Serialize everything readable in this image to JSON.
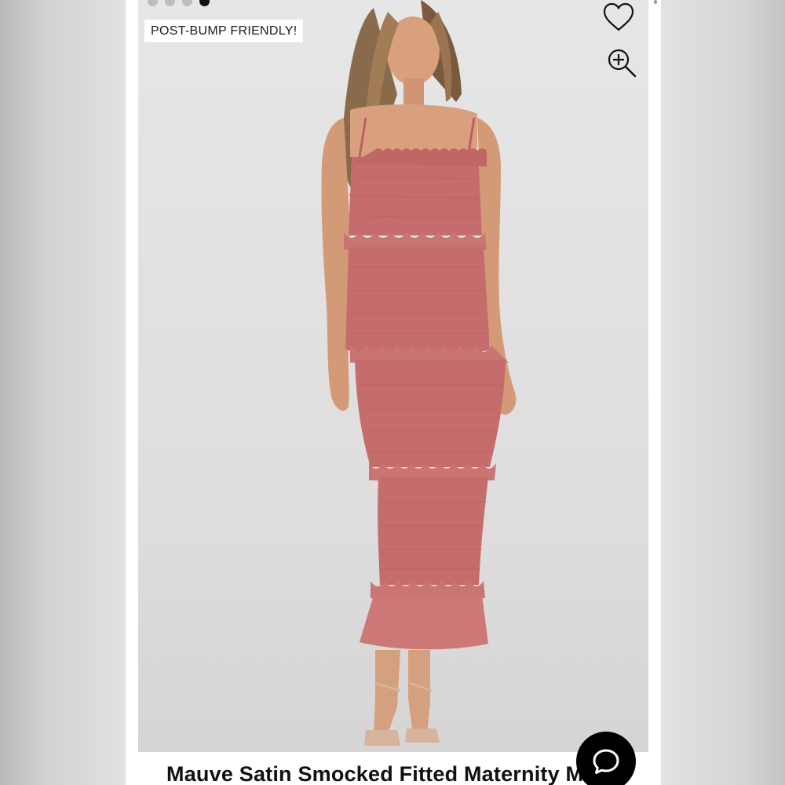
{
  "product": {
    "title": "Mauve Satin Smocked Fitted Maternity M",
    "badge": "POST-BUMP FRIENDLY!"
  },
  "carousel": {
    "total_images": 4,
    "active_index": 3
  },
  "icons": {
    "wishlist": "heart-icon",
    "zoom": "zoom-in-icon",
    "chat": "chat-bubble-icon"
  },
  "colors": {
    "dress": "#c66f6e",
    "background": "#e4e3e3",
    "badge_bg": "#ffffff",
    "chat_bg": "#000000"
  }
}
